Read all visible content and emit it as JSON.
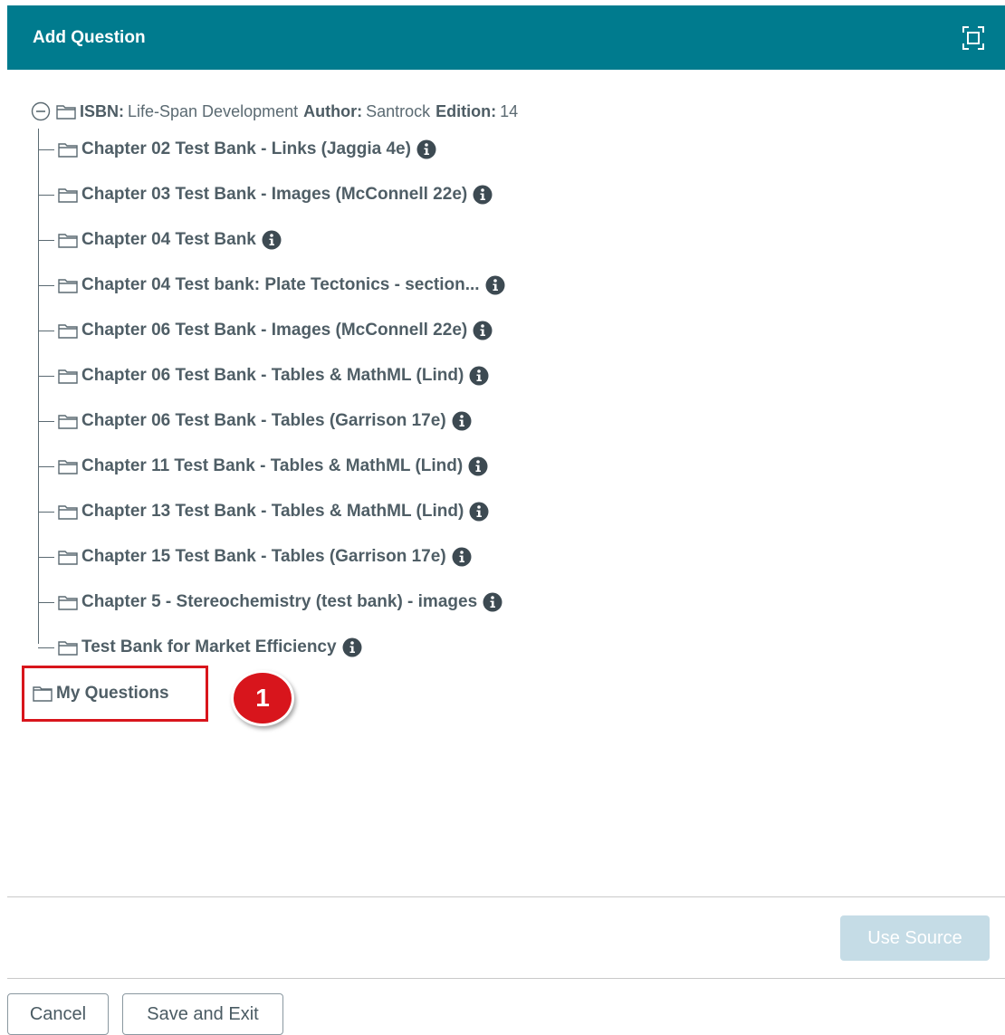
{
  "dialog": {
    "title": "Add Question",
    "expand_icon": "fullscreen-icon"
  },
  "tree": {
    "root": {
      "isbn_label": "ISBN:",
      "isbn_value": "Life-Span Development",
      "author_label": "Author:",
      "author_value": "Santrock",
      "edition_label": "Edition:",
      "edition_value": "14"
    },
    "children": [
      {
        "label": "Chapter 02 Test Bank - Links (Jaggia 4e)"
      },
      {
        "label": "Chapter 03 Test Bank - Images (McConnell 22e)"
      },
      {
        "label": "Chapter 04 Test Bank"
      },
      {
        "label": "Chapter 04 Test bank: Plate Tectonics - section..."
      },
      {
        "label": "Chapter 06 Test Bank - Images (McConnell 22e)"
      },
      {
        "label": "Chapter 06 Test Bank - Tables & MathML (Lind)"
      },
      {
        "label": "Chapter 06 Test Bank - Tables (Garrison 17e)"
      },
      {
        "label": "Chapter 11 Test Bank - Tables & MathML (Lind)"
      },
      {
        "label": "Chapter 13 Test Bank - Tables & MathML (Lind)"
      },
      {
        "label": "Chapter 15 Test Bank - Tables (Garrison 17e)"
      },
      {
        "label": "Chapter 5 - Stereochemistry (test bank) - images"
      },
      {
        "label": "Test Bank for Market Efficiency"
      }
    ],
    "my_questions": "My Questions"
  },
  "callout": {
    "number": "1",
    "color": "#d8151c"
  },
  "buttons": {
    "use_source": "Use Source",
    "cancel": "Cancel",
    "save_exit": "Save and Exit"
  },
  "colors": {
    "header": "#007b8e",
    "text": "#4f5e66",
    "use_source_disabled": "#c5dce6"
  }
}
